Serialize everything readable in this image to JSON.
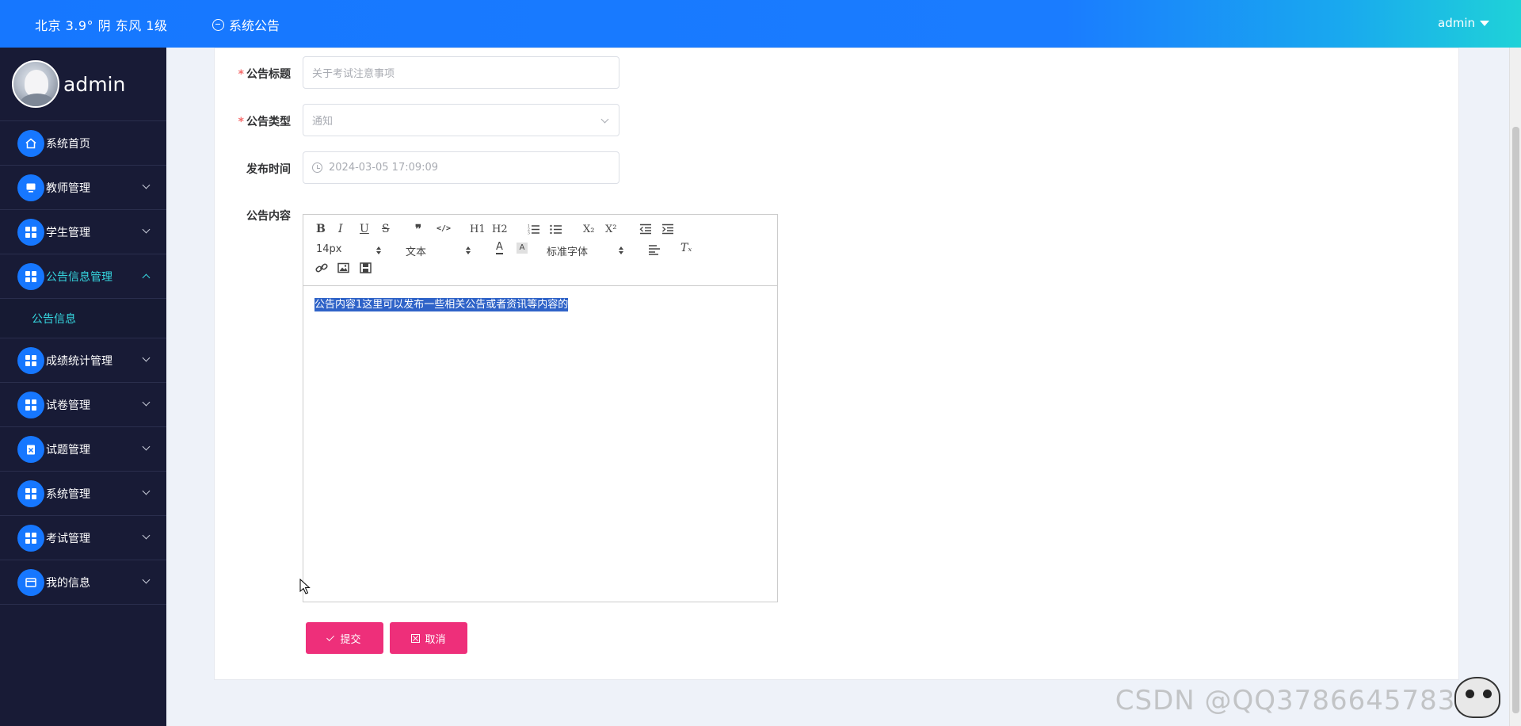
{
  "topbar": {
    "weather": "北京  3.9°  阴  东风  1级",
    "notice": "系统公告",
    "user": "admin"
  },
  "sidebar": {
    "username": "admin",
    "items": [
      {
        "label": "系统首页"
      },
      {
        "label": "教师管理"
      },
      {
        "label": "学生管理"
      },
      {
        "label": "公告信息管理"
      },
      {
        "label": "公告信息"
      },
      {
        "label": "成绩统计管理"
      },
      {
        "label": "试卷管理"
      },
      {
        "label": "试题管理"
      },
      {
        "label": "系统管理"
      },
      {
        "label": "考试管理"
      },
      {
        "label": "我的信息"
      }
    ]
  },
  "form": {
    "title_label": "公告标题",
    "title_placeholder": "关于考试注意事项",
    "type_label": "公告类型",
    "type_value": "通知",
    "time_label": "发布时间",
    "time_value": "2024-03-05 17:09:09",
    "content_label": "公告内容",
    "required_mark": "*"
  },
  "editor": {
    "font_size": "14px",
    "header_select": "文本",
    "font_family": "标准字体",
    "content": "公告内容1这里可以发布一些相关公告或者资讯等内容的",
    "buttons": {
      "bold": "B",
      "italic": "I",
      "underline": "U",
      "strike": "S",
      "quote": "❞",
      "code": "</>",
      "h1": "H1",
      "h2": "H2",
      "sub": "X₂",
      "sup": "X²",
      "color": "A",
      "clean": "Tₓ"
    }
  },
  "actions": {
    "submit": "提交",
    "cancel": "取消"
  },
  "watermark": "CSDN @QQ37866457831",
  "colors": {
    "primary": "#1677ff",
    "sidebar_bg": "#181b36",
    "accent_cyan": "#36d7e0",
    "button_pink": "#ee2f7a"
  }
}
